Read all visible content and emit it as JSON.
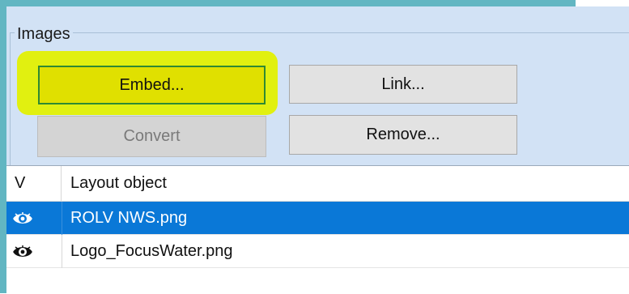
{
  "group": {
    "title": "Images"
  },
  "buttons": {
    "embed": "Embed...",
    "link": "Link...",
    "convert": "Convert",
    "remove": "Remove..."
  },
  "list": {
    "columns": [
      "V",
      "Layout object"
    ],
    "rows": [
      {
        "visible_icon": "eye-icon",
        "name": "ROLV NWS.png",
        "selected": true
      },
      {
        "visible_icon": "eye-icon",
        "name": "Logo_FocusWater.png",
        "selected": false
      }
    ]
  },
  "colors": {
    "panel_bg": "#d2e2f5",
    "highlight": "#e1f010",
    "selection": "#0a78d7",
    "frame": "#62b6c2"
  }
}
